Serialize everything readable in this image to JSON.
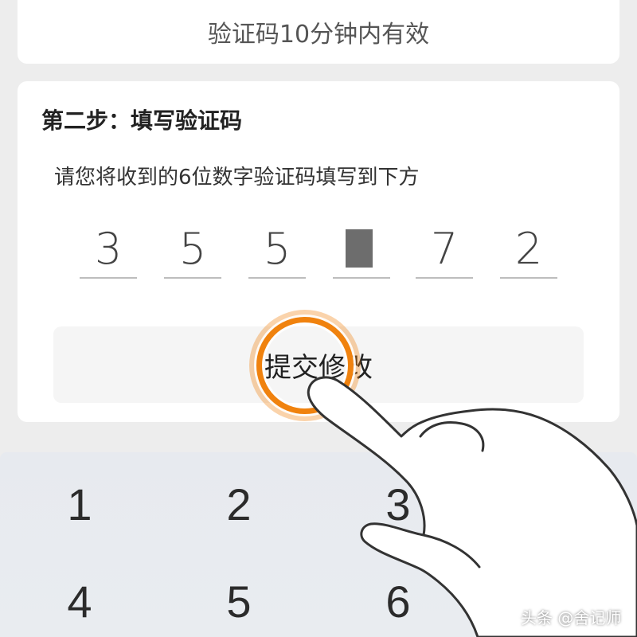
{
  "header": {
    "validity_text": "验证码10分钟内有效"
  },
  "step": {
    "title": "第二步：填写验证码",
    "instruction": "请您将收到的6位数字验证码填写到下方"
  },
  "code_digits": [
    "3",
    "5",
    "5",
    "",
    "7",
    "2"
  ],
  "submit_label": "提交修改",
  "keypad": {
    "keys": [
      "1",
      "2",
      "3",
      "4",
      "5",
      "6"
    ]
  },
  "watermark": "头条 @舍记师",
  "colors": {
    "tap_ring": "#f0820e",
    "card": "#ffffff",
    "keypad_bg": "#e8ebef"
  }
}
